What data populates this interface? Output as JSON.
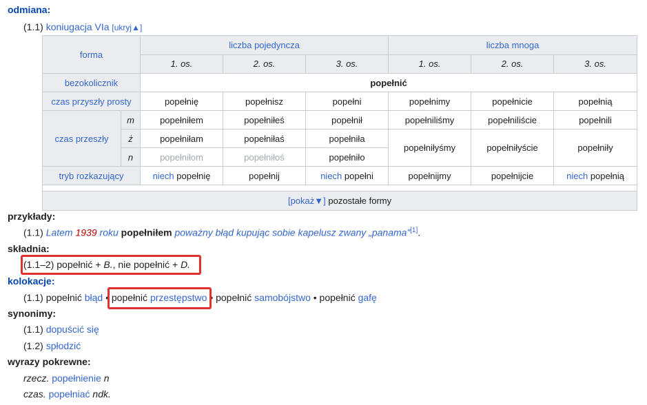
{
  "sections": {
    "odmiana": "odmiana:",
    "przyklady": "przykłady:",
    "skladnia": "składnia:",
    "kolokacje": "kolokacje:",
    "synonimy": "synonimy:",
    "wyrazy": "wyrazy pokrewne:"
  },
  "odmiana_line": {
    "num": "(1.1)",
    "link": "koniugacja VIa",
    "toggle": "[ukryj▲]"
  },
  "table": {
    "forma": "forma",
    "liczba_poj": "liczba pojedyncza",
    "liczba_mn": "liczba mnoga",
    "os": [
      "1. os.",
      "2. os.",
      "3. os.",
      "1. os.",
      "2. os.",
      "3. os."
    ],
    "bezokolicznik": "bezokolicznik",
    "bezokolicznik_val": "popełnić",
    "czas_przyszly": "czas przyszły prosty",
    "czas_przyszly_vals": [
      "popełnię",
      "popełnisz",
      "popełni",
      "popełnimy",
      "popełnicie",
      "popełnią"
    ],
    "czas_przeszly": "czas przeszły",
    "genders": [
      "m",
      "ż",
      "n"
    ],
    "m_vals": [
      "popełniłem",
      "popełniłeś",
      "popełnił",
      "popełniliśmy",
      "popełniliście",
      "popełnili"
    ],
    "z_vals": [
      "popełniłam",
      "popełniłaś",
      "popełniła"
    ],
    "n_vals": [
      "popełniłom",
      "popełniłoś",
      "popełniło"
    ],
    "plural_nonvir": [
      "popełniłyśmy",
      "popełniłyście",
      "popełniły"
    ],
    "tryb": "tryb rozkazujący",
    "niech": "niech",
    "tryb_vals": [
      "popełnię",
      "popełnij",
      "popełni",
      "popełnijmy",
      "popełnijcie",
      "popełnią"
    ],
    "pokaz": "[pokaż▼]",
    "pozostale": "pozostałe formy"
  },
  "przyklady": {
    "num": "(1.1)",
    "p1": "Latem",
    "year": "1939",
    "p2": "roku",
    "bold": "popełniłem",
    "p3": "poważny błąd kupując sobie kapelusz zwany „panama”",
    "ref": "[1]",
    "end": "."
  },
  "skladnia": {
    "num": "(1.1–2)",
    "t1": "popełnić +",
    "b": "B.",
    "t2": ", nie popełnić +",
    "d": "D."
  },
  "kolokacje": {
    "num": "(1.1)",
    "c1a": "popełnić",
    "c1b": "błąd",
    "c2a": "popełnić",
    "c2b": "przestępstwo",
    "c3a": "popełnić",
    "c3b": "samobójstwo",
    "c4a": "popełnić",
    "c4b": "gafę",
    "sep": "•"
  },
  "synonimy": [
    {
      "num": "(1.1)",
      "word": "dopuścić się"
    },
    {
      "num": "(1.2)",
      "word": "spłodzić"
    }
  ],
  "wyrazy": [
    {
      "pos": "rzecz.",
      "word": "popełnienie",
      "tag": "n"
    },
    {
      "pos": "czas.",
      "word": "popełniać",
      "tag": "ndk."
    }
  ]
}
